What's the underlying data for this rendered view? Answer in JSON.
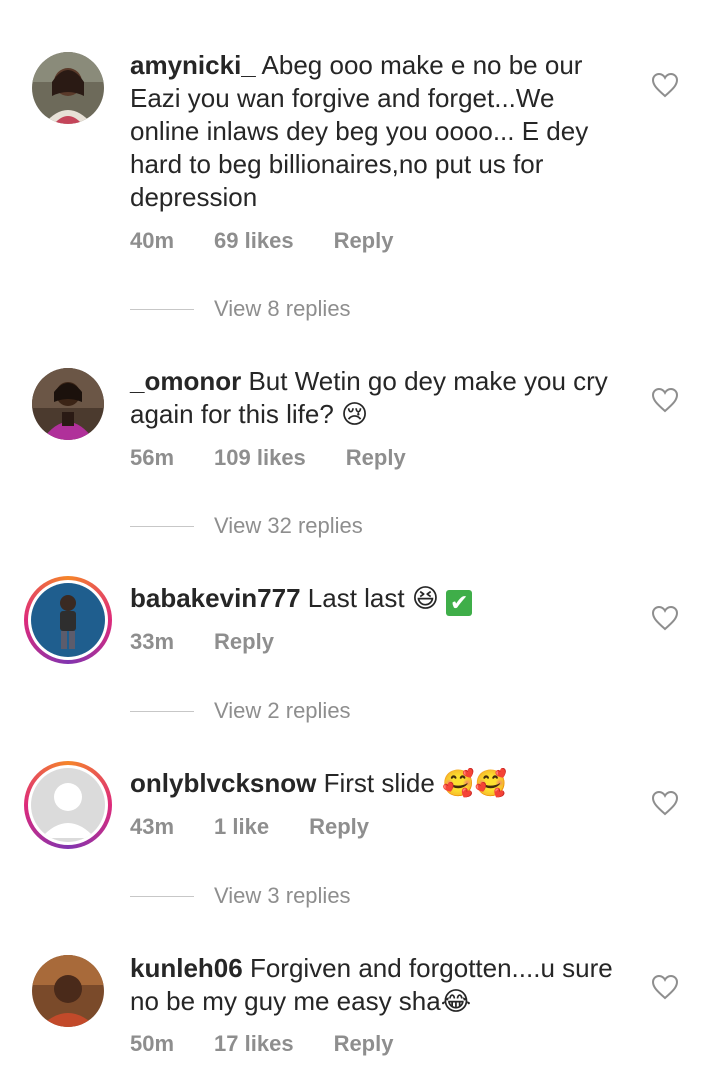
{
  "comments": [
    {
      "username": "amynicki_",
      "text": " Abeg ooo make e no be our Eazi you wan forgive and forget...We online inlaws dey beg you oooo... E dey hard to beg billionaires,no put us for depression",
      "time": "40m",
      "likes": "69 likes",
      "reply": "Reply",
      "view_replies": "View 8 replies"
    },
    {
      "username": "_omonor",
      "text": " But Wetin go dey make you cry again for this life? 😢",
      "time": "56m",
      "likes": "109 likes",
      "reply": "Reply",
      "view_replies": "View 32 replies"
    },
    {
      "username": "babakevin777",
      "text": " Last last 😆",
      "time": "33m",
      "likes": "",
      "reply": "Reply",
      "view_replies": "View 2 replies"
    },
    {
      "username": "onlyblvcksnow",
      "text": " First slide 🥰🥰",
      "time": "43m",
      "likes": "1 like",
      "reply": "Reply",
      "view_replies": "View 3 replies"
    },
    {
      "username": "kunleh06",
      "text": " Forgiven and forgotten....u sure no be my guy me easy sha😂",
      "time": "50m",
      "likes": "17 likes",
      "reply": "Reply"
    }
  ],
  "icons": {
    "heart": "heart-outline-icon",
    "check": "check-mark-icon"
  },
  "check_glyph": "✔",
  "colors": {
    "text": "#262626",
    "muted": "#8e8e8e",
    "story_ring": [
      "#f58529",
      "#dd2a7b",
      "#8134af"
    ]
  }
}
